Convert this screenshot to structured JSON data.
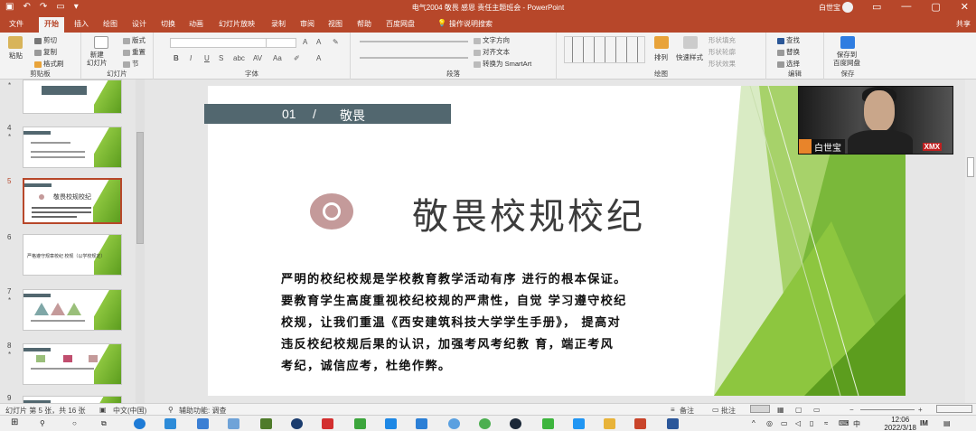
{
  "titlebar": {
    "doc_title": "电气2004 敬畏 感恩 责任主题班会 - PowerPoint",
    "user_name": "白世宝",
    "min": "—",
    "restore": "▢",
    "close": "✕"
  },
  "tabs": [
    "文件",
    "开始",
    "插入",
    "绘图",
    "设计",
    "切换",
    "动画",
    "幻灯片放映",
    "录制",
    "审阅",
    "视图",
    "帮助",
    "百度网盘",
    "操作说明搜索"
  ],
  "share_label": "共享",
  "ribbon": {
    "clipboard": {
      "paste": "粘贴",
      "cut": "剪切",
      "copy": "复制",
      "format_painter": "格式刷",
      "label": "剪贴板"
    },
    "slides": {
      "new_slide": "新建\n幻灯片",
      "layout": "版式",
      "reset": "重置",
      "section": "节",
      "label": "幻灯片"
    },
    "font": {
      "label": "字体"
    },
    "paragraph": {
      "text_direction": "文字方向",
      "align_text": "对齐文本",
      "convert_smartart": "转换为 SmartArt",
      "label": "段落"
    },
    "drawing": {
      "arrange": "排列",
      "quick_styles": "快速样式",
      "shape_fill": "形状填充",
      "shape_outline": "形状轮廓",
      "shape_effects": "形状效果",
      "label": "绘图"
    },
    "editing": {
      "find": "查找",
      "replace": "替换",
      "select": "选择",
      "label": "编辑"
    },
    "save": {
      "save_to_baidu": "保存到\n百度网盘",
      "label": "保存"
    }
  },
  "slide_panel": {
    "numbers": [
      "4",
      "5",
      "6",
      "7",
      "8",
      "9"
    ],
    "thumb6_text": "严格遵守规章校纪 校规（以学校规定）",
    "thumb5_title": "敬畏校规校纪"
  },
  "slide": {
    "header_num": "01",
    "header_sep": "/",
    "header_text": "敬畏",
    "title": "敬畏校规校纪",
    "body_lines": [
      "严明的校纪校规是学校教育教学活动有序 进行的根本保证。",
      "要教育学生高度重视校纪校规的严肃性，自觉 学习遵守校纪",
      "校规，让我们重温《西安建筑科技大学学生手册》， 提高对",
      "违反校纪校规后果的认识，加强考风考纪教 育，端正考风",
      "考纪，诚信应考，杜绝作弊。"
    ]
  },
  "video": {
    "name": "白世宝",
    "badge": "XMX"
  },
  "statusbar": {
    "slide_info": "幻灯片 第 5 张，共 16 张",
    "language": "中文(中国)",
    "accessibility": "辅助功能: 调查",
    "notes": "备注",
    "comments": "批注"
  },
  "taskbar": {
    "time": "12:06",
    "date": "2022/3/18",
    "ime": "中"
  },
  "colors": {
    "accent": "#b7472a",
    "slide_header": "#52676f",
    "green": "#8dc63f"
  }
}
